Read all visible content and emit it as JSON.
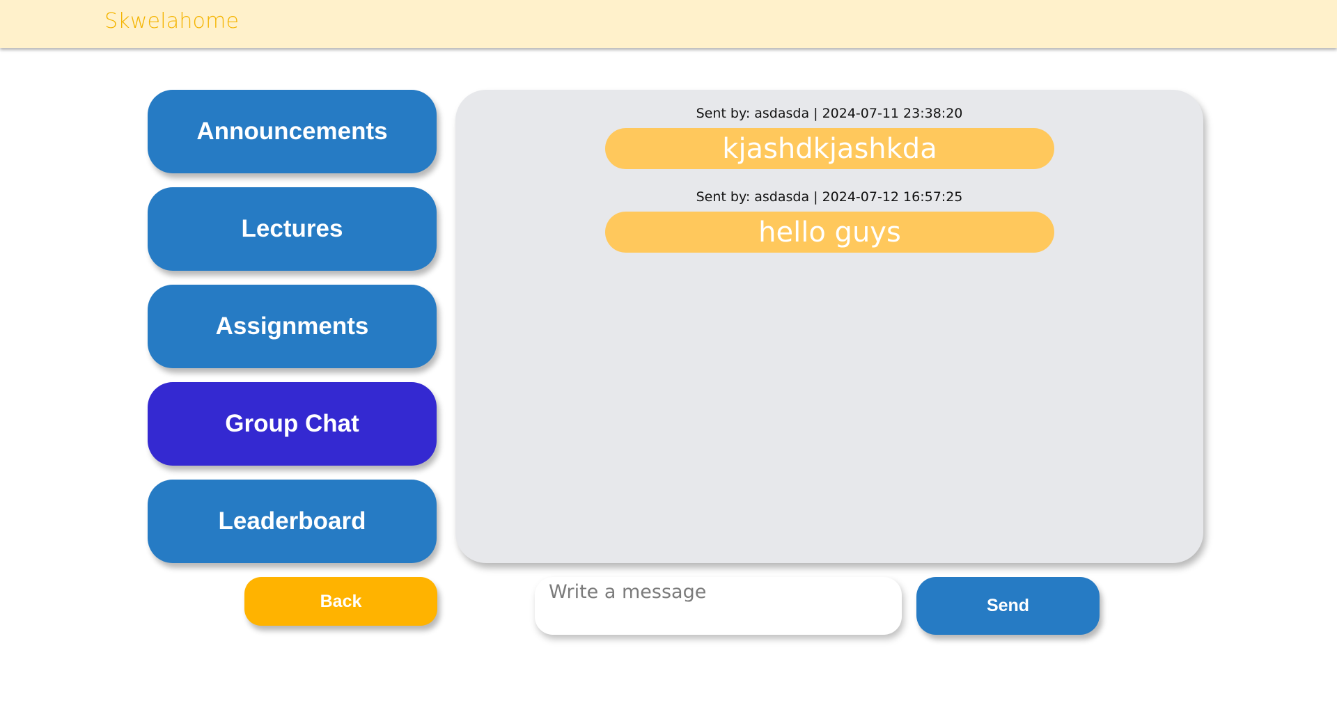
{
  "header": {
    "brand": "Skwelahome",
    "background_color": "#fff1cb",
    "brand_color": "#f4b400"
  },
  "sidebar": {
    "items": [
      {
        "label": "Announcements",
        "active": false
      },
      {
        "label": "Lectures",
        "active": false
      },
      {
        "label": "Assignments",
        "active": false
      },
      {
        "label": "Group Chat",
        "active": true
      },
      {
        "label": "Leaderboard",
        "active": false
      }
    ],
    "button_color": "#267bc4",
    "active_color": "#3429d1"
  },
  "chat": {
    "messages": [
      {
        "meta": "Sent by: asdasda | 2024-07-11 23:38:20",
        "text": "kjashdkjashkda"
      },
      {
        "meta": "Sent by: asdasda | 2024-07-12 16:57:25",
        "text": "hello guys"
      }
    ],
    "panel_color": "#e7e8eb",
    "bubble_color": "#ffc85c"
  },
  "footer": {
    "back_label": "Back",
    "back_color": "#ffb300",
    "input_placeholder": "Write a message",
    "input_value": "",
    "send_label": "Send"
  }
}
